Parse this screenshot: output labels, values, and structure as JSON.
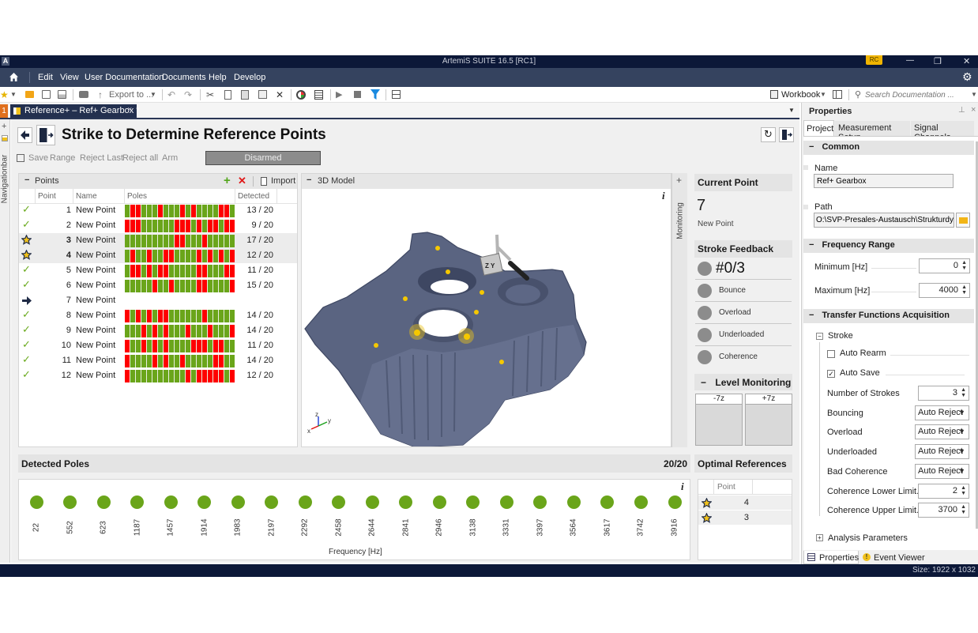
{
  "window": {
    "app_icon": "A",
    "title": "ArtemiS SUITE 16.5 [RC1]",
    "user_badge": "RC",
    "minimize": "—",
    "restore": "❐",
    "close": "✕"
  },
  "menu": {
    "items": [
      "Edit",
      "View",
      "User Documentation",
      "Documents",
      "Help",
      "Develop"
    ]
  },
  "toolbar": {
    "export_label": "Export to ...",
    "workbook_label": "Workbook",
    "search_placeholder": "Search Documentation ..."
  },
  "tabs": {
    "index_badge": "1",
    "active_tab": "Reference+ – Ref+ Gearbox *",
    "close_glyph": "×"
  },
  "navbar": {
    "label": "Navigationbar",
    "add": "+"
  },
  "page": {
    "title": "Strike to Determine Reference Points",
    "actions": [
      "Save",
      "Range",
      "Reject Last",
      "Reject all",
      "Arm"
    ],
    "arm_status": "Disarmed"
  },
  "points": {
    "title": "Points",
    "collapse": "−",
    "import_label": "Import",
    "columns": [
      "Point",
      "Name",
      "Poles",
      "Detected"
    ],
    "rows": [
      {
        "status": "check",
        "point": "1",
        "name": "New Point",
        "poles": "10011101110101111001",
        "detected": "13 / 20",
        "highlight": false
      },
      {
        "status": "check",
        "point": "2",
        "name": "New Point",
        "poles": "00011111100010100100",
        "detected": "9 / 20",
        "highlight": false
      },
      {
        "status": "star",
        "point": "3",
        "name": "New Point",
        "poles": "11111111100111011111",
        "detected": "17 / 20",
        "highlight": true
      },
      {
        "status": "star",
        "point": "4",
        "name": "New Point",
        "poles": "10110110011110101010",
        "detected": "12 / 20",
        "highlight": true
      },
      {
        "status": "check",
        "point": "5",
        "name": "New Point",
        "poles": "10010100111110011100",
        "detected": "11 / 20",
        "highlight": false
      },
      {
        "status": "check",
        "point": "6",
        "name": "New Point",
        "poles": "11111011011110011110",
        "detected": "15 / 20",
        "highlight": false
      },
      {
        "status": "current",
        "point": "7",
        "name": "New Point",
        "poles": "",
        "detected": "",
        "highlight": false
      },
      {
        "status": "check",
        "point": "8",
        "name": "New Point",
        "poles": "01010100111111011111",
        "detected": "14 / 20",
        "highlight": false
      },
      {
        "status": "check",
        "point": "9",
        "name": "New Point",
        "poles": "11101010111011101110",
        "detected": "14 / 20",
        "highlight": false
      },
      {
        "status": "check",
        "point": "10",
        "name": "New Point",
        "poles": "01101010111100010011",
        "detected": "11 / 20",
        "highlight": false
      },
      {
        "status": "check",
        "point": "11",
        "name": "New Point",
        "poles": "01111010110111110011",
        "detected": "14 / 20",
        "highlight": false
      },
      {
        "status": "check",
        "point": "12",
        "name": "New Point",
        "poles": "01111111111010000010",
        "detected": "12 / 20",
        "highlight": false
      }
    ]
  },
  "model": {
    "title": "3D Model",
    "collapse": "−",
    "info": "i",
    "axes": {
      "x": "x",
      "y": "y",
      "z": "z"
    }
  },
  "monitoring": {
    "label": "Monitoring",
    "expand": "+"
  },
  "current_point": {
    "title": "Current Point",
    "number": "7",
    "name": "New Point"
  },
  "stroke_feedback": {
    "title": "Stroke Feedback",
    "counter": "#0/3",
    "items": [
      "Bounce",
      "Overload",
      "Underloaded",
      "Coherence"
    ]
  },
  "level_monitoring": {
    "title": "Level Monitoring",
    "collapse": "−",
    "channels": [
      "-7z",
      "+7z"
    ]
  },
  "detected_poles": {
    "title": "Detected Poles",
    "count": "20/20",
    "info": "i",
    "xlabel": "Frequency [Hz]",
    "frequencies": [
      "22",
      "552",
      "623",
      "1187",
      "1457",
      "1914",
      "1983",
      "2197",
      "2292",
      "2458",
      "2644",
      "2841",
      "2946",
      "3138",
      "3331",
      "3397",
      "3564",
      "3617",
      "3742",
      "3916"
    ]
  },
  "optimal_references": {
    "title": "Optimal References",
    "column": "Point",
    "rows": [
      "4",
      "3"
    ]
  },
  "properties": {
    "title": "Properties",
    "tabs": [
      "Project",
      "Measurement Setup",
      "Signal Channels"
    ],
    "common": {
      "title": "Common",
      "name_label": "Name",
      "name_value": "Ref+ Gearbox",
      "path_label": "Path",
      "path_value": "O:\\SVP-Presales-Austausch\\Strukturdyna"
    },
    "frequency_range": {
      "title": "Frequency Range",
      "min_label": "Minimum [Hz]",
      "min_value": "0",
      "max_label": "Maximum [Hz]",
      "max_value": "4000"
    },
    "tfa": {
      "title": "Transfer Functions Acquisition",
      "stroke_label": "Stroke",
      "auto_rearm": {
        "label": "Auto Rearm",
        "checked": false
      },
      "auto_save": {
        "label": "Auto Save",
        "checked": true
      },
      "fields": [
        {
          "label": "Number of Strokes",
          "value": "3",
          "type": "spin"
        },
        {
          "label": "Bouncing",
          "value": "Auto Reject",
          "type": "select"
        },
        {
          "label": "Overload",
          "value": "Auto Reject",
          "type": "select"
        },
        {
          "label": "Underloaded",
          "value": "Auto Reject",
          "type": "select"
        },
        {
          "label": "Bad Coherence",
          "value": "Auto Reject",
          "type": "select"
        },
        {
          "label": "Coherence Lower Limit...",
          "value": "2",
          "type": "spin"
        },
        {
          "label": "Coherence Upper Limit...",
          "value": "3700",
          "type": "spin"
        }
      ]
    },
    "analysis_label": "Analysis Parameters",
    "bottom_tabs": [
      "Properties",
      "Event Viewer"
    ]
  },
  "status": {
    "size": "Size: 1922 x 1032"
  },
  "colors": {
    "title_bar": "#0c1838",
    "menu_bar": "#35435f",
    "pole_detected": "#6aa51a",
    "pole_missing": "#ff0000",
    "check": "#6aaa1e",
    "star": "#f2c21b",
    "badge": "#f0b400",
    "tab_index": "#e0701e"
  }
}
